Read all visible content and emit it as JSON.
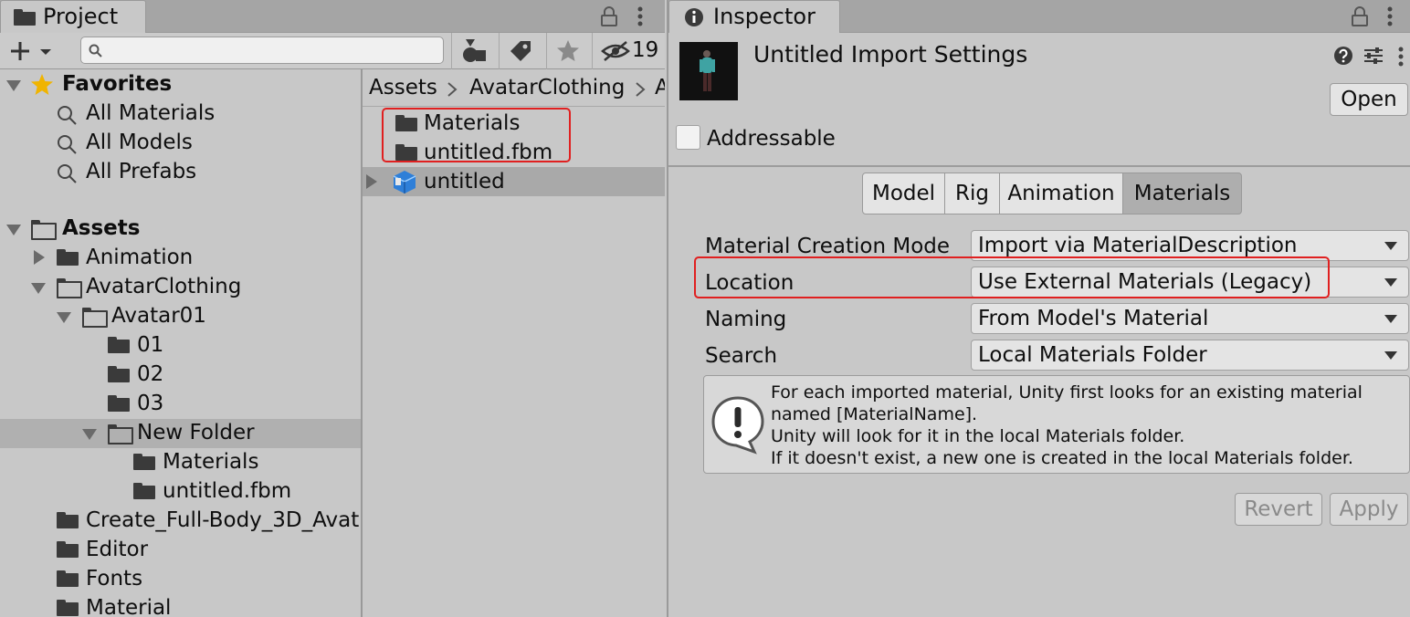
{
  "project": {
    "tab_label": "Project",
    "hidden_count": "19",
    "search": {
      "value": "",
      "placeholder": ""
    },
    "tree": {
      "favorites_label": "Favorites",
      "favorites": [
        "All Materials",
        "All Models",
        "All Prefabs"
      ],
      "assets_label": "Assets",
      "items": {
        "animation": "Animation",
        "avatar_clothing": "AvatarClothing",
        "avatar01": "Avatar01",
        "f01": "01",
        "f02": "02",
        "f03": "03",
        "new_folder": "New Folder",
        "materials": "Materials",
        "untitled_fbm": "untitled.fbm",
        "create_full_body": "Create_Full-Body_3D_Avat",
        "editor": "Editor",
        "fonts": "Fonts",
        "material": "Material"
      }
    },
    "breadcrumb": [
      "Assets",
      "AvatarClothing",
      "A"
    ],
    "list": {
      "materials": "Materials",
      "untitled_fbm": "untitled.fbm",
      "untitled": "untitled"
    }
  },
  "inspector": {
    "tab_label": "Inspector",
    "title": "Untitled Import Settings",
    "open_button": "Open",
    "addressable_label": "Addressable",
    "addressable_checked": false,
    "tabs": [
      "Model",
      "Rig",
      "Animation",
      "Materials"
    ],
    "active_tab": "Materials",
    "fields": {
      "material_creation_mode": {
        "label": "Material Creation Mode",
        "value": "Import via MaterialDescription"
      },
      "location": {
        "label": "Location",
        "value": "Use External Materials (Legacy)"
      },
      "naming": {
        "label": "Naming",
        "value": "From Model's Material"
      },
      "search": {
        "label": "Search",
        "value": "Local Materials Folder"
      }
    },
    "info_lines": [
      "For each imported material, Unity first looks for an existing material",
      "named [MaterialName].",
      "Unity will look for it in the local Materials folder.",
      "If it doesn't exist, a new one is created in the local Materials folder."
    ],
    "revert_button": "Revert",
    "apply_button": "Apply"
  },
  "colors": {
    "highlight_box": "#e02020",
    "star": "#f0b400",
    "model_icon": "#2f7fd8"
  }
}
